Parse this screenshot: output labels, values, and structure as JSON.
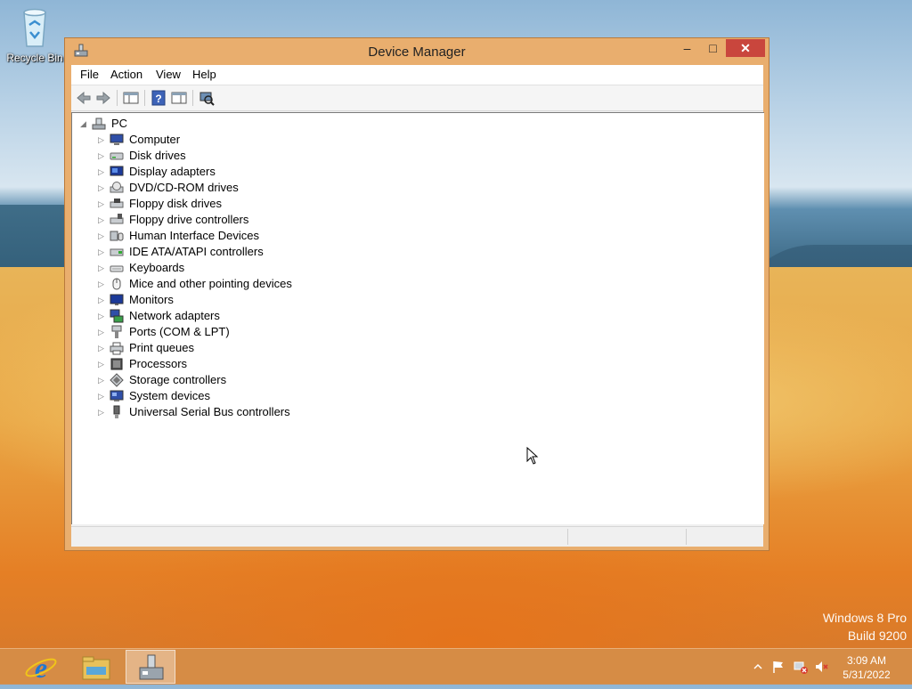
{
  "desktop": {
    "recycle_bin_label": "Recycle Bin",
    "watermark_line1": "Windows 8 Pro",
    "watermark_line2": "Build 9200"
  },
  "window": {
    "title": "Device Manager",
    "minimize_label": "–",
    "maximize_label": "□",
    "close_label": "✕",
    "menu": [
      "File",
      "Action",
      "View",
      "Help"
    ],
    "toolbar_icons": [
      "back-icon",
      "forward-icon",
      "show-hide-console-tree-icon",
      "help-icon",
      "properties-icon",
      "scan-hardware-icon"
    ]
  },
  "tree": {
    "root_label": "PC",
    "root_expanded_glyph": "◢",
    "collapsed_glyph": "▷",
    "categories": [
      {
        "label": "Computer",
        "icon": "computer-icon"
      },
      {
        "label": "Disk drives",
        "icon": "disk-drive-icon"
      },
      {
        "label": "Display adapters",
        "icon": "display-adapter-icon"
      },
      {
        "label": "DVD/CD-ROM drives",
        "icon": "dvd-drive-icon"
      },
      {
        "label": "Floppy disk drives",
        "icon": "floppy-drive-icon"
      },
      {
        "label": "Floppy drive controllers",
        "icon": "floppy-controller-icon"
      },
      {
        "label": "Human Interface Devices",
        "icon": "hid-icon"
      },
      {
        "label": "IDE ATA/ATAPI controllers",
        "icon": "ide-controller-icon"
      },
      {
        "label": "Keyboards",
        "icon": "keyboard-icon"
      },
      {
        "label": "Mice and other pointing devices",
        "icon": "mouse-icon"
      },
      {
        "label": "Monitors",
        "icon": "monitor-icon"
      },
      {
        "label": "Network adapters",
        "icon": "network-adapter-icon"
      },
      {
        "label": "Ports (COM & LPT)",
        "icon": "port-icon"
      },
      {
        "label": "Print queues",
        "icon": "printer-icon"
      },
      {
        "label": "Processors",
        "icon": "processor-icon"
      },
      {
        "label": "Storage controllers",
        "icon": "storage-controller-icon"
      },
      {
        "label": "System devices",
        "icon": "system-device-icon"
      },
      {
        "label": "Universal Serial Bus controllers",
        "icon": "usb-icon"
      }
    ]
  },
  "taskbar": {
    "apps": [
      "internet-explorer-icon",
      "file-explorer-icon",
      "device-manager-taskbar-icon"
    ],
    "tray_icons": [
      "show-hidden-icons-icon",
      "action-center-flag-icon",
      "network-icon",
      "volume-muted-icon"
    ],
    "time": "3:09 AM",
    "date": "5/31/2022"
  },
  "colors": {
    "title_bar": "#e9ae6e",
    "close_button": "#c9463d",
    "taskbar": "#d68c46"
  }
}
